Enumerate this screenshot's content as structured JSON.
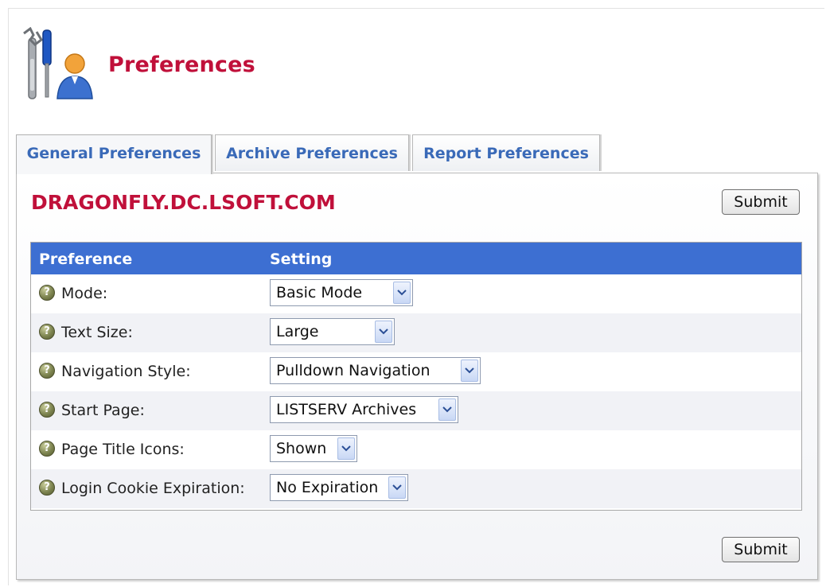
{
  "header": {
    "title": "Preferences",
    "icon": "tools-user-icon"
  },
  "tabs": [
    {
      "label": "General Preferences",
      "active": true
    },
    {
      "label": "Archive Preferences",
      "active": false
    },
    {
      "label": "Report Preferences",
      "active": false
    }
  ],
  "panel": {
    "server_name": "DRAGONFLY.DC.LSOFT.COM",
    "submit_label": "Submit"
  },
  "table": {
    "headers": {
      "preference": "Preference",
      "setting": "Setting"
    },
    "rows": [
      {
        "label": "Mode:",
        "value": "Basic Mode"
      },
      {
        "label": "Text Size:",
        "value": "Large"
      },
      {
        "label": "Navigation Style:",
        "value": "Pulldown Navigation"
      },
      {
        "label": "Start Page:",
        "value": "LISTSERV Archives"
      },
      {
        "label": "Page Title Icons:",
        "value": "Shown"
      },
      {
        "label": "Login Cookie Expiration:",
        "value": "No Expiration"
      }
    ],
    "help_glyph": "?"
  },
  "colors": {
    "title": "#c0103a",
    "tab_text": "#3a6ab8",
    "table_header": "#3d6fd2"
  }
}
